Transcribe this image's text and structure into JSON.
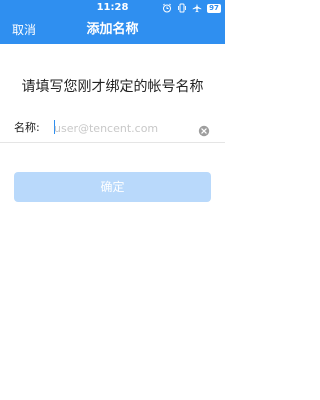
{
  "status_bar": {
    "time": "11:28",
    "icons": [
      "alarm-icon",
      "vibrate-icon",
      "airplane-icon"
    ],
    "battery_level": "97"
  },
  "title_bar": {
    "cancel_label": "取消",
    "title": "添加名称"
  },
  "main": {
    "prompt": "请填写您刚才绑定的帐号名称",
    "name_field": {
      "label": "名称:",
      "value": "",
      "placeholder": "user@tencent.com"
    },
    "confirm_label": "确定"
  },
  "colors": {
    "primary": "#2f8ff0",
    "button_disabled": "#b9d9fb",
    "placeholder": "#c8c8c8"
  }
}
